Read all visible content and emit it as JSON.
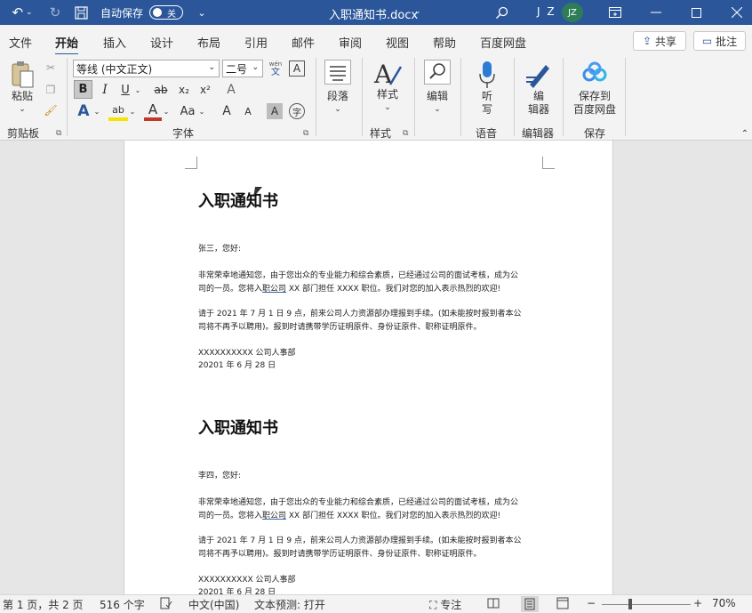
{
  "titlebar": {
    "autosave_label": "自动保存",
    "autosave_state": "关",
    "title": "入职通知书.docx",
    "user_initials": "J Z",
    "avatar": "JZ",
    "colors": {
      "bar": "#2b579a",
      "avatar": "#2e7d57"
    }
  },
  "tabs": [
    "文件",
    "开始",
    "插入",
    "设计",
    "布局",
    "引用",
    "邮件",
    "审阅",
    "视图",
    "帮助",
    "百度网盘"
  ],
  "actions": {
    "share": "共享",
    "comment": "批注"
  },
  "ribbon": {
    "clipboard": {
      "paste": "粘贴",
      "label": "剪贴板"
    },
    "font": {
      "font_name": "等线 (中文正文)",
      "font_size": "二号",
      "phonetic": "wén",
      "phonetic_sub": "文",
      "border_char": "A",
      "bold": "B",
      "italic": "I",
      "underline": "U",
      "strike": "ab",
      "sub": "x₂",
      "sup": "x²",
      "clear": "A",
      "effects": "A",
      "highlight": "ab",
      "color": "A",
      "case": "Aa",
      "grow": "A",
      "shrink": "A",
      "shade": "A",
      "enclose": "字",
      "label": "字体"
    },
    "paragraph": {
      "label": "段落"
    },
    "styles": {
      "btn": "样式",
      "label": "样式"
    },
    "editing": {
      "btn": "编辑"
    },
    "voice": {
      "btn_line1": "听",
      "btn_line2": "写",
      "label": "语音"
    },
    "editor": {
      "btn_line1": "编",
      "btn_line2": "辑器",
      "label": "编辑器"
    },
    "save": {
      "btn_line1": "保存到",
      "btn_line2": "百度网盘",
      "label": "保存"
    }
  },
  "document": {
    "letters": [
      {
        "title": "入职通知书",
        "greeting": "张三，您好:",
        "p1_line1": "非常荣幸地通知您，由于您出众的专业能力和综合素质，已经通过公司的面试考核，成为公",
        "p1_line2_a": "司的一员。您将入",
        "p1_line2_link": "职公司",
        "p1_line2_b": " XX 部门担任  XXXX 职位。我们对您的加入表示热烈的欢迎!",
        "p2_line1": "请于 2021 年  7 月 1 日 9 点，前来公司人力资源部办理报到手续。(如未能按时报到者本公",
        "p2_line2": "司将不再予以聘用)。报到时请携带学历证明原件、身份证原件、职称证明原件。",
        "sign": "XXXXXXXXXX 公司人事部",
        "date": "20201 年 6 月 28 日"
      },
      {
        "title": "入职通知书",
        "greeting": "李四，您好:",
        "p1_line1": "非常荣幸地通知您，由于您出众的专业能力和综合素质，已经通过公司的面试考核，成为公",
        "p1_line2_a": "司的一员。您将入",
        "p1_line2_link": "职公司",
        "p1_line2_b": " XX 部门担任  XXXX 职位。我们对您的加入表示热烈的欢迎!",
        "p2_line1": "请于 2021 年  7 月 1 日 9 点，前来公司人力资源部办理报到手续。(如未能按时报到者本公",
        "p2_line2": "司将不再予以聘用)。报到时请携带学历证明原件、身份证原件、职称证明原件。",
        "sign": "XXXXXXXXXX 公司人事部",
        "date": "20201 年 6 月 28 日"
      }
    ]
  },
  "statusbar": {
    "page": "第 1 页，共 2 页",
    "words": "516 个字",
    "language": "中文(中国)",
    "prediction": "文本预测: 打开",
    "focus": "专注",
    "zoom_minus": "−",
    "zoom_plus": "+",
    "zoom": "70%",
    "zoom_percent": 70
  }
}
